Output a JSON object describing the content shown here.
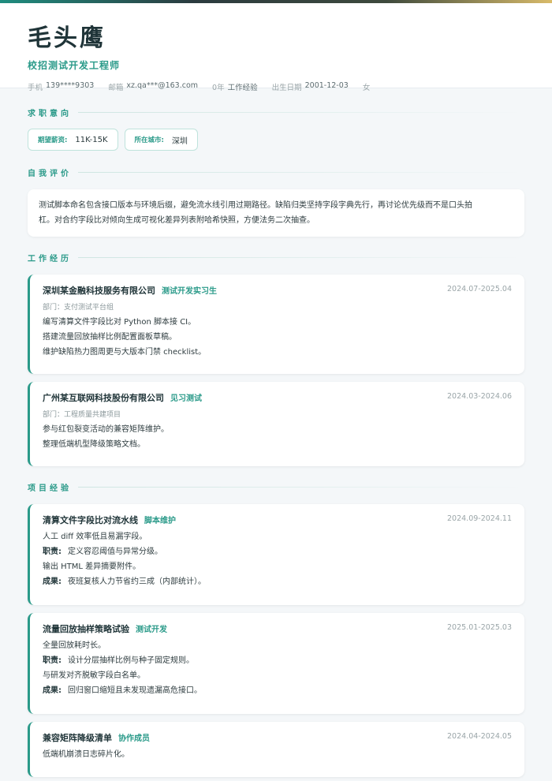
{
  "profile": {
    "name": "毛头鹰",
    "role": "校招测试开发工程师",
    "phone_label": "手机",
    "phone": "139****9303",
    "email_label": "邮箱",
    "email": "xz.qa***@163.com",
    "experience_years": "0年",
    "experience_label": "工作经验",
    "birth_label": "出生日期",
    "birth": "2001-12-03",
    "gender": "女"
  },
  "sections": {
    "intention": "求职意向",
    "summary": "自我评价",
    "work": "工作经历",
    "projects": "项目经验"
  },
  "intention": {
    "salary_label": "期望薪资:",
    "salary": "11K-15K",
    "city_label": "所在城市:",
    "city": "深圳"
  },
  "summary_lines": [
    "测试脚本命名包含接口版本与环境后缀，避免流水线引用过期路径。缺陷归类坚持字段字典先行，再讨论优先级而不是口头拍",
    "杠。对合约字段比对倾向生成可视化差异列表附哈希快照，方便法务二次抽查。"
  ],
  "work": [
    {
      "company": "深圳某金融科技服务有限公司",
      "position": "测试开发实习生",
      "date": "2024.07-2025.04",
      "dept": "部门：支付测试平台组",
      "bullets": [
        "编写清算文件字段比对 Python 脚本接 CI。",
        "搭建流量回放抽样比例配置面板草稿。",
        "维护缺陷热力图周更与大版本门禁 checklist。"
      ]
    },
    {
      "company": "广州某互联网科技股份有限公司",
      "position": "见习测试",
      "date": "2024.03-2024.06",
      "dept": "部门：工程质量共建项目",
      "bullets": [
        "参与红包裂变活动的兼容矩阵维护。",
        "整理低端机型降级策略文档。"
      ]
    }
  ],
  "projects": [
    {
      "name": "清算文件字段比对流水线",
      "role": "脚本维护",
      "date": "2024.09-2024.11",
      "background": "人工 diff 效率低且易漏字段。",
      "duty_label": "职责:",
      "duty": "定义容忍阈值与异常分级。",
      "duty_extra": "输出 HTML 差异摘要附件。",
      "result_label": "成果:",
      "result": "夜班复核人力节省约三成（内部统计）。"
    },
    {
      "name": "流量回放抽样策略试验",
      "role": "测试开发",
      "date": "2025.01-2025.03",
      "background": "全量回放耗时长。",
      "duty_label": "职责:",
      "duty": "设计分层抽样比例与种子固定规则。",
      "duty_extra": "与研发对齐脱敏字段白名单。",
      "result_label": "成果:",
      "result": "回归窗口缩短且未发现遗漏高危接口。"
    },
    {
      "name": "兼容矩阵降级清单",
      "role": "协作成员",
      "date": "2024.04-2024.05",
      "background": "低端机崩溃日志碎片化。"
    }
  ]
}
